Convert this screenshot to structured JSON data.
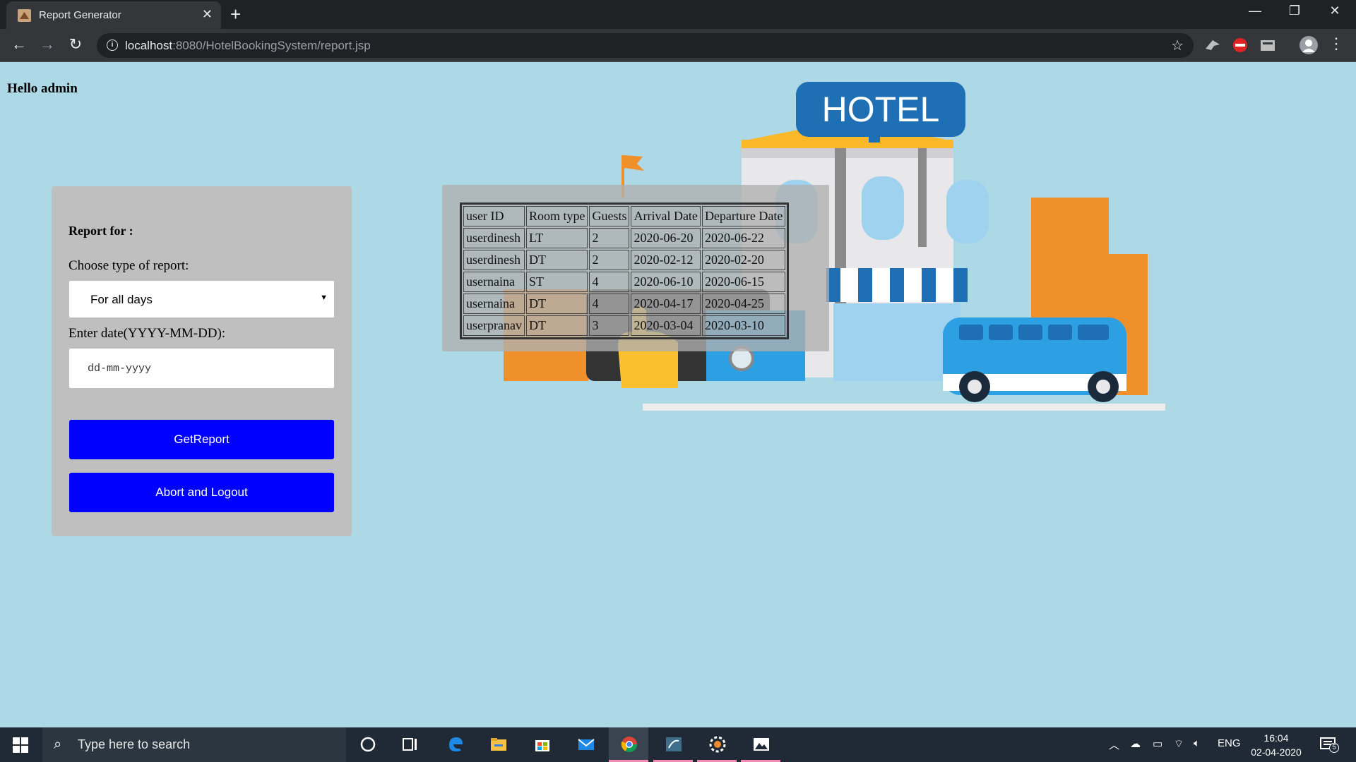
{
  "browser": {
    "tab_title": "Report Generator",
    "tab_close": "✕",
    "new_tab": "+",
    "window_controls": {
      "minimize": "—",
      "restore": "❐",
      "close": "✕"
    },
    "nav": {
      "back": "←",
      "forward": "→",
      "reload": "↻"
    },
    "url_host": "localhost",
    "url_path": ":8080/HotelBookingSystem/report.jsp",
    "info_icon": "i",
    "bookmark_icon": "☆",
    "menu_icon": "⋮"
  },
  "page": {
    "greeting": "Hello admin",
    "form": {
      "heading": "Report for :",
      "type_label": "Choose type of report:",
      "type_selected": "For all days",
      "date_label": "Enter date(YYYY-MM-DD):",
      "date_placeholder": "dd-mm-yyyy",
      "get_report_label": "GetReport",
      "logout_label": "Abort and Logout"
    },
    "illustration": {
      "sign_text": "HOTEL"
    },
    "report_table": {
      "headers": [
        "user ID",
        "Room type",
        "Guests",
        "Arrival Date",
        "Departure Date"
      ],
      "rows": [
        [
          "userdinesh",
          "LT",
          "2",
          "2020-06-20",
          "2020-06-22"
        ],
        [
          "userdinesh",
          "DT",
          "2",
          "2020-02-12",
          "2020-02-20"
        ],
        [
          "usernaina",
          "ST",
          "4",
          "2020-06-10",
          "2020-06-15"
        ],
        [
          "usernaina",
          "DT",
          "4",
          "2020-04-17",
          "2020-04-25"
        ],
        [
          "userpranav",
          "DT",
          "3",
          "2020-03-04",
          "2020-03-10"
        ]
      ]
    }
  },
  "taskbar": {
    "search_placeholder": "Type here to search",
    "language": "ENG",
    "time": "16:04",
    "date": "02-04-2020",
    "notification_count": "5",
    "active_app": "chrome"
  },
  "colors": {
    "page_bg": "#add8e6",
    "button_bg": "#0000ff",
    "card_bg": "#bfbfbf"
  }
}
